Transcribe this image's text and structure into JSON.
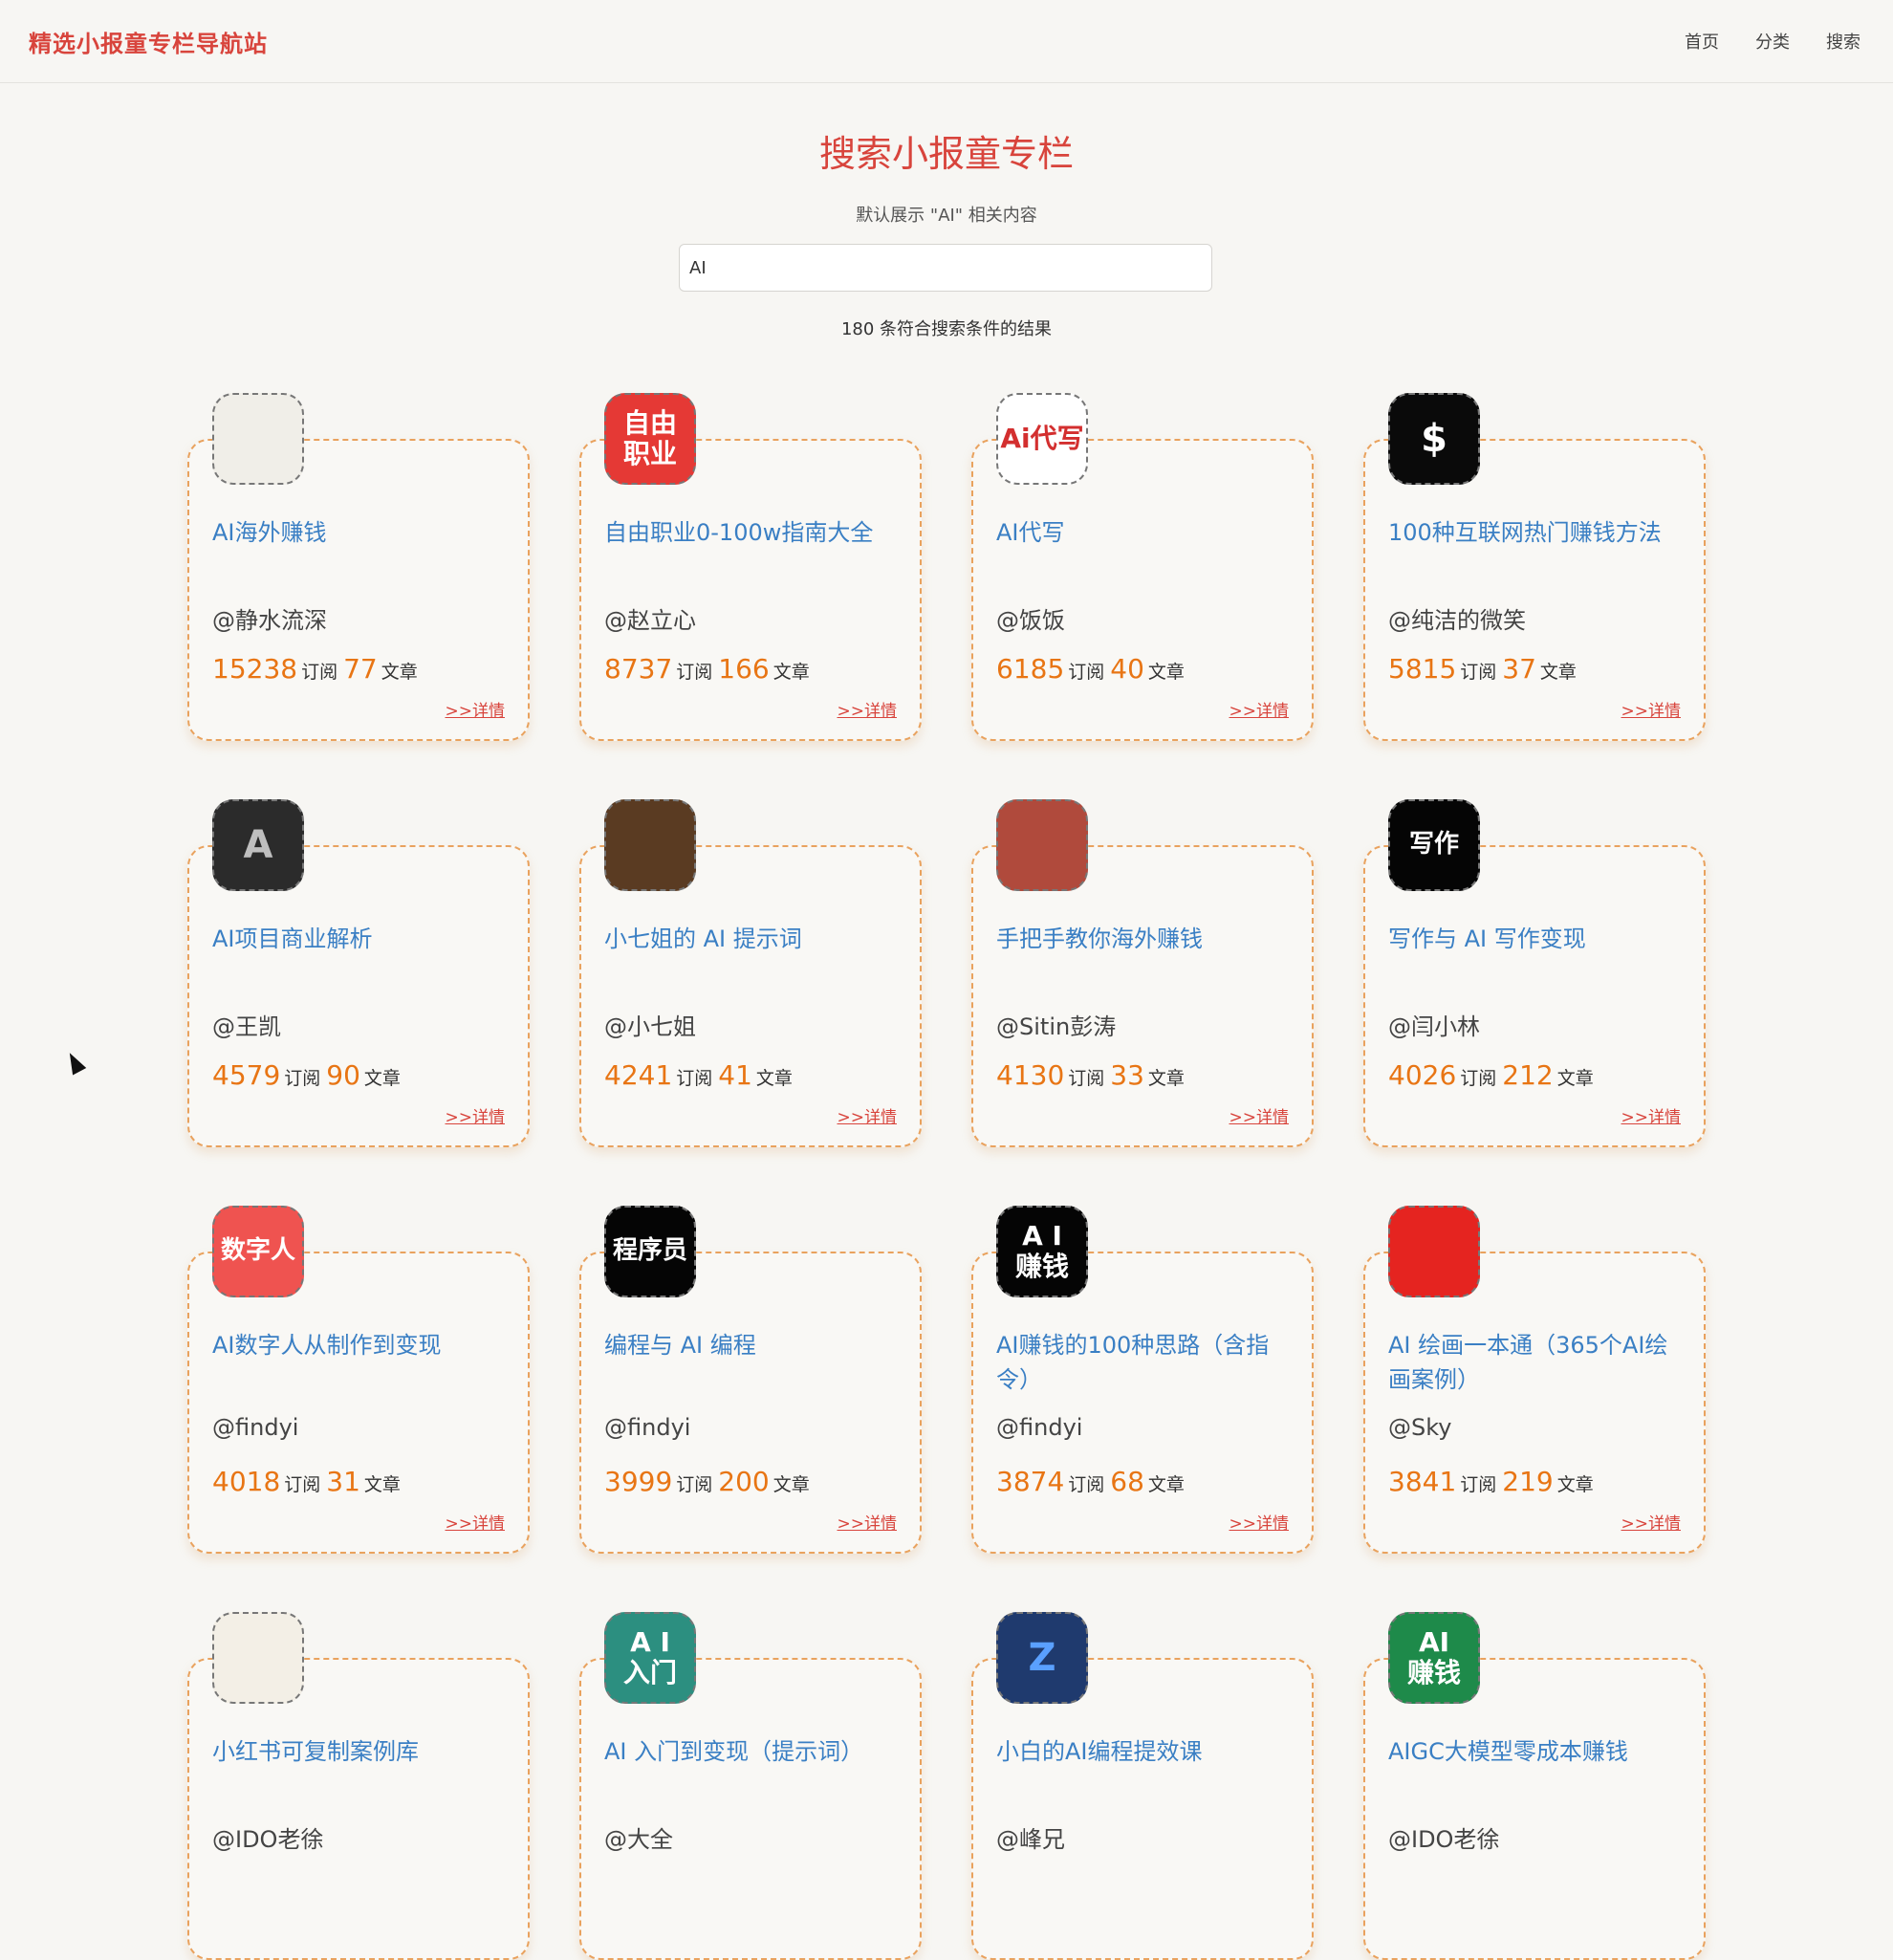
{
  "nav": {
    "brand": "精选小报童专栏导航站",
    "links": [
      "首页",
      "分类",
      "搜索"
    ]
  },
  "hero": {
    "title": "搜索小报童专栏",
    "subtitle": "默认展示 \"AI\" 相关内容"
  },
  "search": {
    "value": "AI"
  },
  "result_count": "180 条符合搜索条件的结果",
  "labels": {
    "subscribe": "订阅",
    "articles": "文章",
    "detail": ">>详情"
  },
  "cards": [
    {
      "title": "AI海外赚钱",
      "author": "@静水流深",
      "subs": "15238",
      "posts": "77",
      "avatar_text": "",
      "avatar_bg": "#f0eee8",
      "avatar_fg": "#222",
      "avatar_icon": "money-icon"
    },
    {
      "title": "自由职业0-100w指南大全",
      "author": "@赵立心",
      "subs": "8737",
      "posts": "166",
      "avatar_text": "自由\n职业",
      "avatar_bg": "#e53935",
      "avatar_fg": "#ffffff",
      "avatar_icon": ""
    },
    {
      "title": "AI代写",
      "author": "@饭饭",
      "subs": "6185",
      "posts": "40",
      "avatar_text": "Ai代写",
      "avatar_bg": "#ffffff",
      "avatar_fg": "#d32f2f",
      "avatar_icon": ""
    },
    {
      "title": "100种互联网热门赚钱方法",
      "author": "@纯洁的微笑",
      "subs": "5815",
      "posts": "37",
      "avatar_text": "$",
      "avatar_bg": "#0a0a0a",
      "avatar_fg": "#ffffff",
      "avatar_icon": "dollar-icon"
    },
    {
      "title": "AI项目商业解析",
      "author": "@王凯",
      "subs": "4579",
      "posts": "90",
      "avatar_text": "A",
      "avatar_bg": "#2b2b2b",
      "avatar_fg": "#bfbfbf",
      "avatar_icon": ""
    },
    {
      "title": "小七姐的 AI 提示词",
      "author": "@小七姐",
      "subs": "4241",
      "posts": "41",
      "avatar_text": "",
      "avatar_bg": "#5a3b22",
      "avatar_fg": "#f0d9a8",
      "avatar_icon": "cat-icon"
    },
    {
      "title": "手把手教你海外赚钱",
      "author": "@Sitin彭涛",
      "subs": "4130",
      "posts": "33",
      "avatar_text": "",
      "avatar_bg": "#b04a3c",
      "avatar_fg": "#f0e0c0",
      "avatar_icon": "money-tree-icon"
    },
    {
      "title": "写作与 AI 写作变现",
      "author": "@闫小林",
      "subs": "4026",
      "posts": "212",
      "avatar_text": "写作",
      "avatar_bg": "#050505",
      "avatar_fg": "#ffffff",
      "avatar_icon": ""
    },
    {
      "title": "AI数字人从制作到变现",
      "author": "@findyi",
      "subs": "4018",
      "posts": "31",
      "avatar_text": "数字人",
      "avatar_bg": "#ef5350",
      "avatar_fg": "#ffffff",
      "avatar_icon": ""
    },
    {
      "title": "编程与 AI 编程",
      "author": "@findyi",
      "subs": "3999",
      "posts": "200",
      "avatar_text": "程序员",
      "avatar_bg": "#050505",
      "avatar_fg": "#ffffff",
      "avatar_icon": ""
    },
    {
      "title": "AI赚钱的100种思路（含指令）",
      "author": "@findyi",
      "subs": "3874",
      "posts": "68",
      "avatar_text": "A I\n赚钱",
      "avatar_bg": "#050505",
      "avatar_fg": "#ffffff",
      "avatar_icon": ""
    },
    {
      "title": "AI 绘画一本通（365个AI绘画案例）",
      "author": "@Sky",
      "subs": "3841",
      "posts": "219",
      "avatar_text": "",
      "avatar_bg": "#e52420",
      "avatar_fg": "#ffffff",
      "avatar_icon": "brush-icon"
    },
    {
      "title": "小红书可复制案例库",
      "author": "@IDO老徐",
      "subs": "",
      "posts": "",
      "avatar_text": "",
      "avatar_bg": "#f3efe6",
      "avatar_fg": "#222",
      "avatar_icon": "portrait-icon"
    },
    {
      "title": "AI 入门到变现（提示词）",
      "author": "@大全",
      "subs": "",
      "posts": "",
      "avatar_text": "A I\n入门",
      "avatar_bg": "#2c8f80",
      "avatar_fg": "#ffffff",
      "avatar_icon": ""
    },
    {
      "title": "小白的AI编程提效课",
      "author": "@峰兄",
      "subs": "",
      "posts": "",
      "avatar_text": "Z",
      "avatar_bg": "#1f3a6e",
      "avatar_fg": "#5aa0ff",
      "avatar_icon": ""
    },
    {
      "title": "AIGC大模型零成本赚钱",
      "author": "@IDO老徐",
      "subs": "",
      "posts": "",
      "avatar_text": "AI\n赚钱",
      "avatar_bg": "#1e8a4a",
      "avatar_fg": "#ffffff",
      "avatar_icon": ""
    }
  ]
}
